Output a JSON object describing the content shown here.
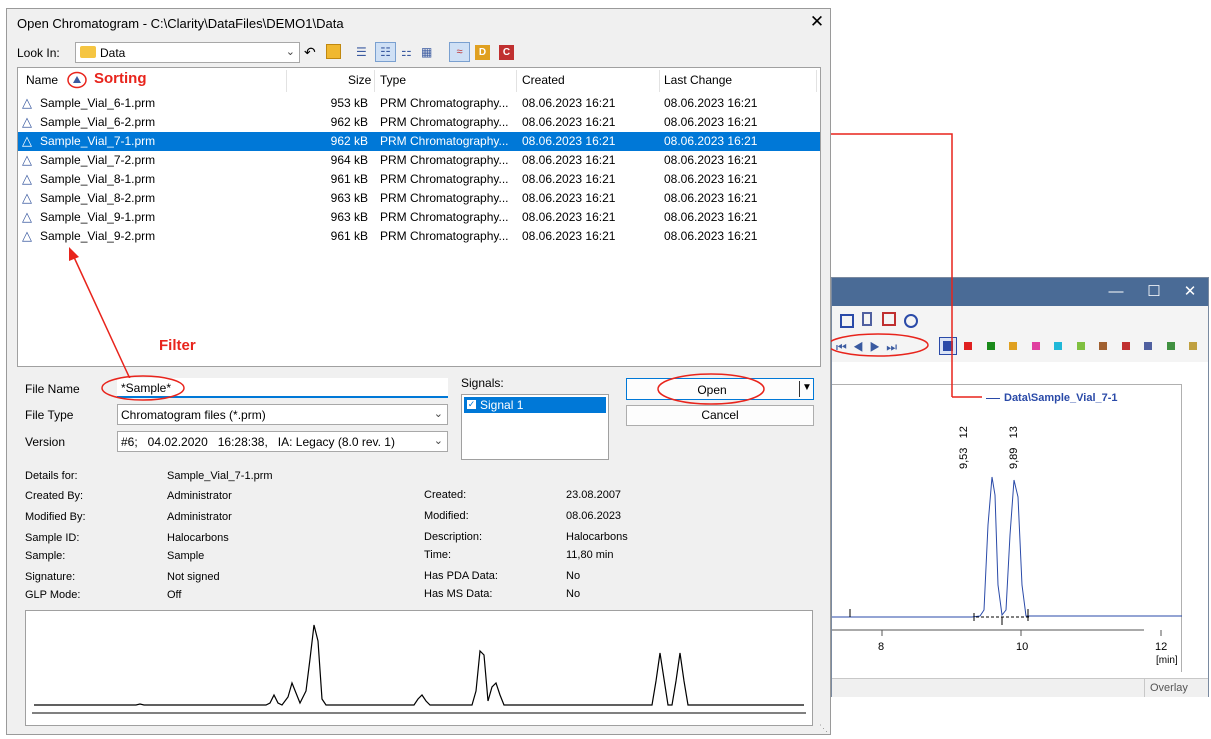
{
  "dialog": {
    "title": "Open Chromatogram - C:\\Clarity\\DataFiles\\DEMO1\\Data",
    "look_in_label": "Look In:",
    "look_in_value": "Data",
    "columns": {
      "name": "Name",
      "size": "Size",
      "type": "Type",
      "created": "Created",
      "last_change": "Last Change"
    },
    "files": [
      {
        "name": "Sample_Vial_6-1.prm",
        "size": "953 kB",
        "type": "PRM Chromatography...",
        "created": "08.06.2023 16:21",
        "changed": "08.06.2023 16:21",
        "selected": false
      },
      {
        "name": "Sample_Vial_6-2.prm",
        "size": "962 kB",
        "type": "PRM Chromatography...",
        "created": "08.06.2023 16:21",
        "changed": "08.06.2023 16:21",
        "selected": false
      },
      {
        "name": "Sample_Vial_7-1.prm",
        "size": "962 kB",
        "type": "PRM Chromatography...",
        "created": "08.06.2023 16:21",
        "changed": "08.06.2023 16:21",
        "selected": true
      },
      {
        "name": "Sample_Vial_7-2.prm",
        "size": "964 kB",
        "type": "PRM Chromatography...",
        "created": "08.06.2023 16:21",
        "changed": "08.06.2023 16:21",
        "selected": false
      },
      {
        "name": "Sample_Vial_8-1.prm",
        "size": "961 kB",
        "type": "PRM Chromatography...",
        "created": "08.06.2023 16:21",
        "changed": "08.06.2023 16:21",
        "selected": false
      },
      {
        "name": "Sample_Vial_8-2.prm",
        "size": "963 kB",
        "type": "PRM Chromatography...",
        "created": "08.06.2023 16:21",
        "changed": "08.06.2023 16:21",
        "selected": false
      },
      {
        "name": "Sample_Vial_9-1.prm",
        "size": "963 kB",
        "type": "PRM Chromatography...",
        "created": "08.06.2023 16:21",
        "changed": "08.06.2023 16:21",
        "selected": false
      },
      {
        "name": "Sample_Vial_9-2.prm",
        "size": "961 kB",
        "type": "PRM Chromatography...",
        "created": "08.06.2023 16:21",
        "changed": "08.06.2023 16:21",
        "selected": false
      }
    ],
    "file_name_label": "File Name",
    "file_name_value": "*Sample*",
    "file_type_label": "File Type",
    "file_type_value": "Chromatogram files (*.prm)",
    "version_label": "Version",
    "version_value": "#6;   04.02.2020   16:28:38,   IA: Legacy (8.0 rev. 1)",
    "signals_label": "Signals:",
    "signal_item": "Signal 1",
    "open_button": "Open",
    "cancel_button": "Cancel",
    "details_left": [
      {
        "label": "Details for:",
        "value": "Sample_Vial_7-1.prm"
      },
      {
        "label": "Created By:",
        "value": "Administrator"
      },
      {
        "label": "Modified By:",
        "value": "Administrator"
      },
      {
        "label": "Sample ID:",
        "value": "Halocarbons"
      },
      {
        "label": "Sample:",
        "value": "Sample"
      },
      {
        "label": "Signature:",
        "value": "Not signed"
      },
      {
        "label": "GLP Mode:",
        "value": "Off"
      }
    ],
    "details_right": [
      {
        "label": "Created:",
        "value": "23.08.2007"
      },
      {
        "label": "Modified:",
        "value": "08.06.2023"
      },
      {
        "label": "Description:",
        "value": "Halocarbons"
      },
      {
        "label": "Time:",
        "value": "11,80 min"
      },
      {
        "label": "Has PDA Data:",
        "value": "No"
      },
      {
        "label": "Has MS Data:",
        "value": "No"
      }
    ]
  },
  "annotations": {
    "sorting": "Sorting",
    "filter": "Filter",
    "color": "#e8241c"
  },
  "bg_window": {
    "legend": "Data\\Sample_Vial_7-1",
    "x_ticks": [
      "8",
      "10",
      "12"
    ],
    "x_unit": "[min]",
    "peak_labels": [
      {
        "time": "9,53",
        "num": "12"
      },
      {
        "time": "9,89",
        "num": "13"
      }
    ],
    "status": "Overlay",
    "swatch_colors": [
      "#e02020",
      "#1a8a1a",
      "#e0a020",
      "#e040a0",
      "#20b8d8",
      "#80c040",
      "#a06030",
      "#c03030",
      "#5060a0",
      "#409040",
      "#c0a040"
    ],
    "accent": "#2a4aa8"
  }
}
